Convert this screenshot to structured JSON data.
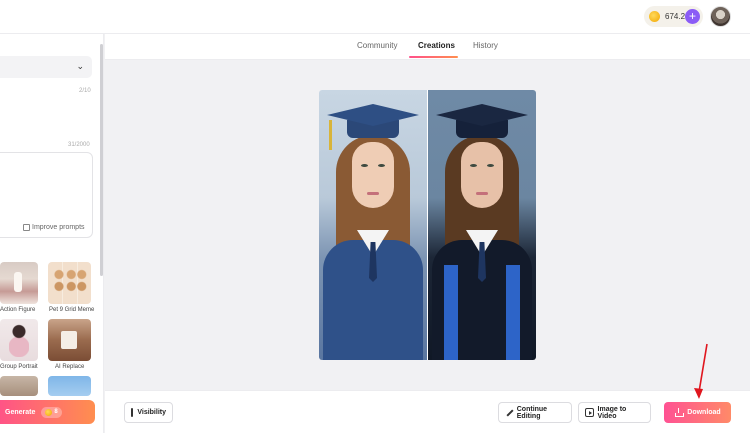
{
  "header": {
    "credits": "674.2",
    "add_label": "+"
  },
  "sidebar": {
    "count_style": "2/10",
    "count_prompt": "31/2000",
    "improve_prompts": "Improve prompts",
    "templates": [
      {
        "label": "Action Figure"
      },
      {
        "label": "Pet 9 Grid Meme"
      },
      {
        "label": "Group Portrait"
      },
      {
        "label": "AI Replace"
      }
    ],
    "generate_label": "Generate",
    "generate_cost": "8"
  },
  "tabs": [
    {
      "label": "Community"
    },
    {
      "label": "Creations"
    },
    {
      "label": "History"
    }
  ],
  "actions": {
    "visibility": "Visibility",
    "continue_editing": "Continue Editing",
    "image_to_video": "Image to Video",
    "download": "Download"
  },
  "colors": {
    "accent_gradient_start": "#ff4f8b",
    "accent_gradient_end": "#ff8e4f",
    "annotation_arrow": "#e0161e",
    "coin": "#f2a600",
    "plus_button": "#8b5cf6"
  }
}
